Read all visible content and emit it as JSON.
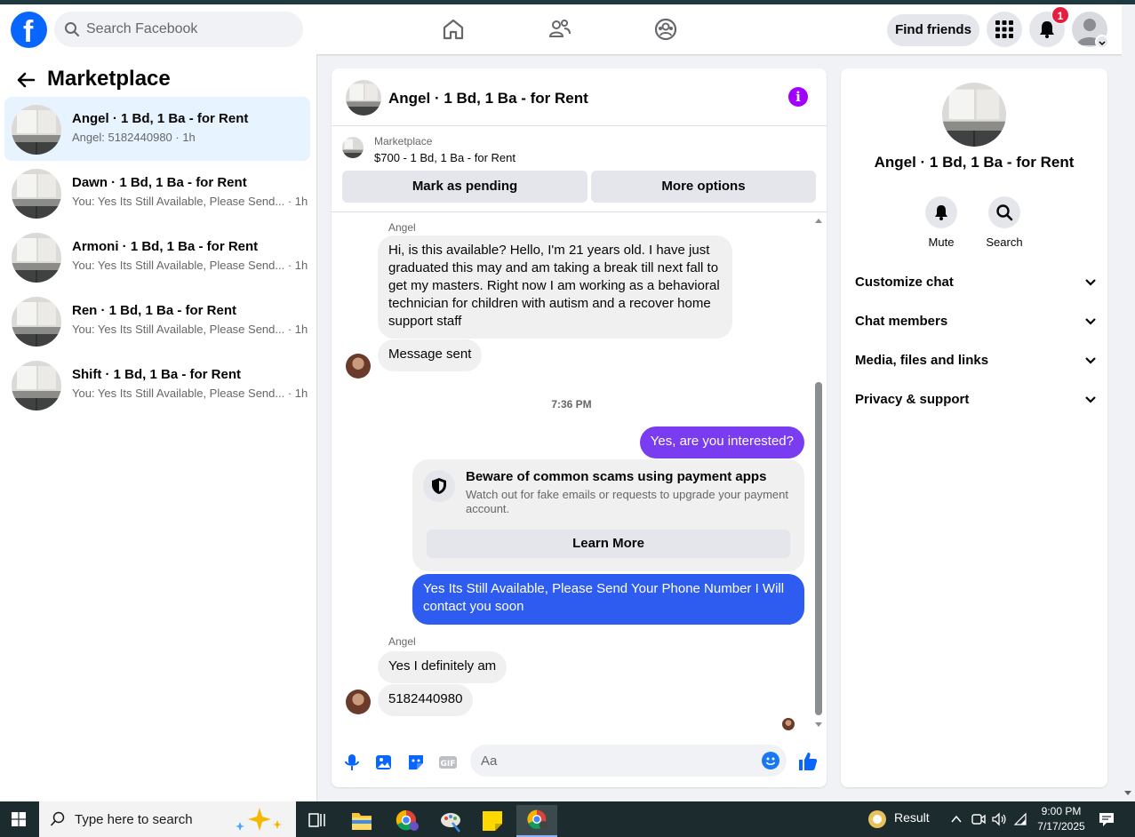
{
  "header": {
    "search_placeholder": "Search Facebook",
    "find_friends_label": "Find friends",
    "notification_count": "1"
  },
  "sidebar": {
    "title": "Marketplace",
    "conversations": [
      {
        "title": "Angel · 1 Bd, 1 Ba - for Rent",
        "preview": "Angel: 5182440980 · 1h"
      },
      {
        "title": "Dawn · 1 Bd, 1 Ba - for Rent",
        "preview": "You: Yes Its Still Available, Please Send... · 1h"
      },
      {
        "title": "Armoni · 1 Bd, 1 Ba - for Rent",
        "preview": "You: Yes Its Still Available, Please Send... · 1h"
      },
      {
        "title": "Ren · 1 Bd, 1 Ba - for Rent",
        "preview": "You: Yes Its Still Available, Please Send... · 1h"
      },
      {
        "title": "Shift · 1 Bd, 1 Ba - for Rent",
        "preview": "You: Yes Its Still Available, Please Send... · 1h"
      }
    ]
  },
  "chat": {
    "title": "Angel · 1 Bd, 1 Ba - for Rent",
    "listing_label": "Marketplace",
    "listing_price": "$700 - 1 Bd, 1 Ba - for Rent",
    "mark_pending_label": "Mark as pending",
    "more_options_label": "More options",
    "sender_name": "Angel",
    "msg1": "Hi, is this available? Hello, I'm 21 years old. I have just graduated this may and am taking a break till next fall to get my masters. Right now I am working as a behavioral technician for children with autism and a recover home support staff",
    "msg2": "Message sent",
    "timestamp": "7:36 PM",
    "msg_out1": "Yes, are you interested?",
    "scam_title": "Beware of common scams using payment apps",
    "scam_text": "Watch out for fake emails or requests to upgrade your payment account.",
    "learn_more_label": "Learn More",
    "msg_out2": "Yes Its Still Available, Please Send Your Phone Number I Will contact you soon",
    "msg3": "Yes I definitely am",
    "msg4": "5182440980",
    "composer_placeholder": "Aa"
  },
  "rightpanel": {
    "title": "Angel · 1 Bd, 1 Ba - for Rent",
    "mute_label": "Mute",
    "search_label": "Search",
    "sections": [
      "Customize chat",
      "Chat members",
      "Media, files and links",
      "Privacy & support"
    ]
  },
  "taskbar": {
    "search_placeholder": "Type here to search",
    "result_label": "Result",
    "time": "9:00 PM",
    "date": "7/17/2025"
  },
  "colors": {
    "facebook_blue": "#0866ff",
    "outgoing_purple": "#7a3cf0",
    "outgoing_blue": "#2e5bf0",
    "info_purple": "#a100ff",
    "active_conversation_bg": "#e7f3ff"
  }
}
